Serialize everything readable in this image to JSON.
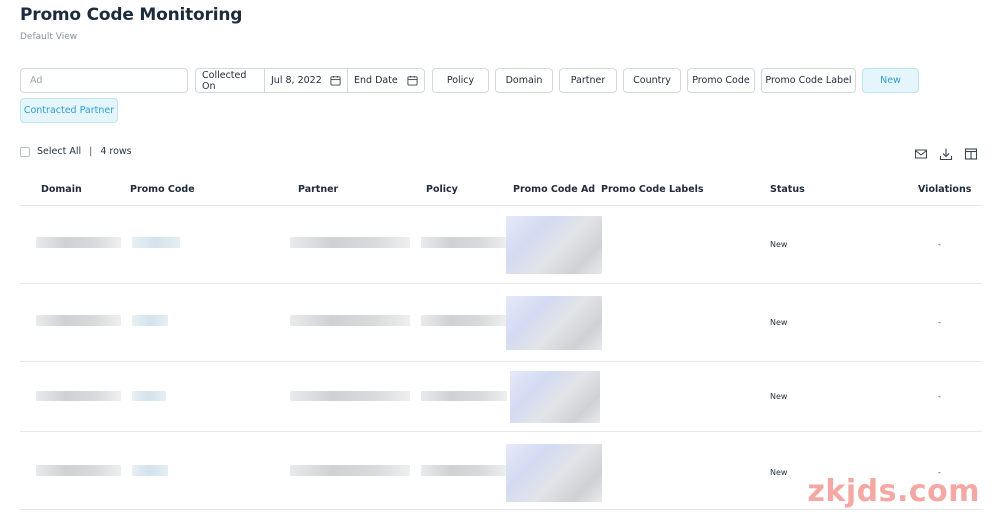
{
  "page": {
    "title": "Promo Code Monitoring",
    "subtitle": "Default View"
  },
  "filters": {
    "ad_placeholder": "Ad",
    "collected_on_label": "Collected On",
    "start_date": "Jul 8, 2022",
    "end_date_placeholder": "End Date",
    "buttons": [
      "Policy",
      "Domain",
      "Partner",
      "Country",
      "Promo Code",
      "Promo Code Label",
      "New",
      "Contracted Partner"
    ],
    "active_buttons": [
      "New",
      "Contracted Partner"
    ]
  },
  "selection": {
    "select_all_label": "Select All",
    "row_count": "4 rows"
  },
  "toolbar_icons": [
    "email-icon",
    "download-icon",
    "columns-icon"
  ],
  "table": {
    "columns": [
      "Domain",
      "Promo Code",
      "Partner",
      "Policy",
      "Promo Code Ad",
      "Promo Code Labels",
      "Status",
      "Violations"
    ],
    "rows": [
      {
        "status": "New",
        "violations": "-"
      },
      {
        "status": "New",
        "violations": "-"
      },
      {
        "status": "New",
        "violations": "-"
      },
      {
        "status": "New",
        "violations": "-"
      }
    ]
  },
  "colors": {
    "active_filter_bg": "#e5f5fc",
    "active_filter_text": "#2f9fd0",
    "border": "#d3d8de"
  },
  "watermark": "zkjds.com"
}
